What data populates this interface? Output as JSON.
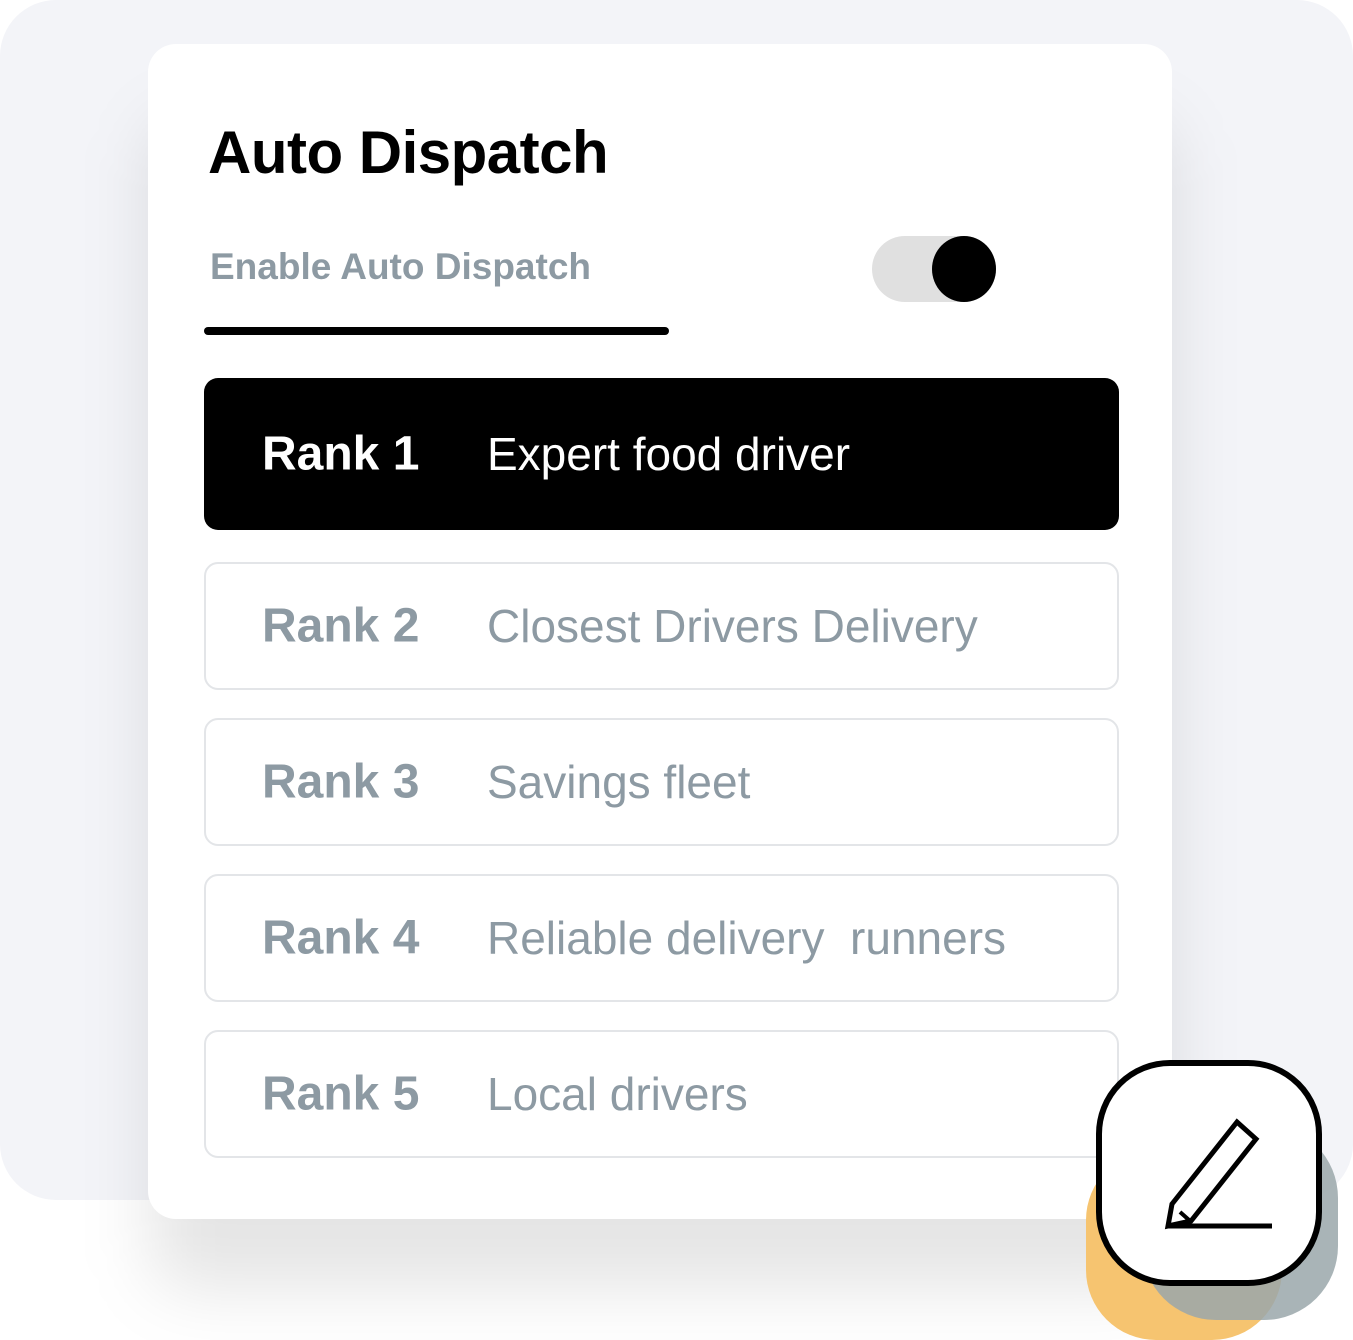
{
  "panel": {
    "title": "Auto Dispatch",
    "enable_label": "Enable Auto Dispatch",
    "toggle_on": true
  },
  "ranks": [
    {
      "label": "Rank 1",
      "description": "Expert food driver",
      "active": true
    },
    {
      "label": "Rank 2",
      "description": "Closest Drivers Delivery",
      "active": false
    },
    {
      "label": "Rank 3",
      "description": "Savings fleet",
      "active": false
    },
    {
      "label": "Rank 4",
      "description": "Reliable delivery  runners",
      "active": false
    },
    {
      "label": "Rank 5",
      "description": "Local drivers",
      "active": false
    }
  ],
  "edit_button": {
    "icon": "pencil-icon"
  },
  "colors": {
    "background": "#f3f4f8",
    "card": "#ffffff",
    "active_row": "#000000",
    "muted_text": "#8d9aa3",
    "toggle_track": "#e0e0e0",
    "accent_yellow": "#f6c470",
    "accent_gray": "#9aa7aa"
  }
}
